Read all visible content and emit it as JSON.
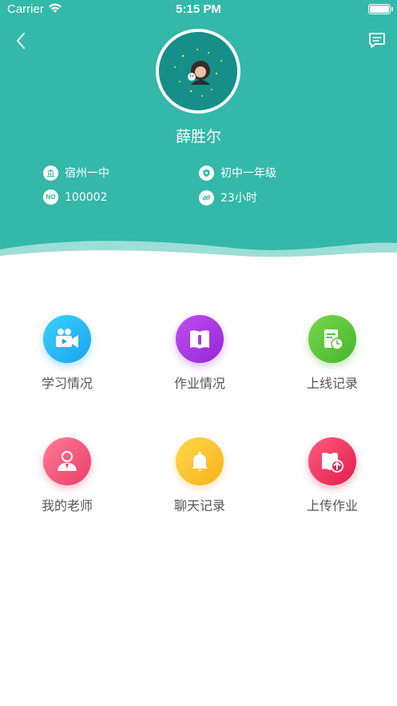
{
  "status_bar": {
    "carrier": "Carrier",
    "time": "5:15 PM"
  },
  "profile": {
    "name": "薛胜尔"
  },
  "info": {
    "school": "宿州一中",
    "grade": "初中一年级",
    "number_badge": "NO",
    "number": "100002",
    "duration": "23小时"
  },
  "menu": [
    {
      "label": "学习情况",
      "icon": "video-camera-icon",
      "color": "#2db8f0"
    },
    {
      "label": "作业情况",
      "icon": "book-icon",
      "color": "#a93ce0"
    },
    {
      "label": "上线记录",
      "icon": "document-clock-icon",
      "color": "#5cc23c"
    },
    {
      "label": "我的老师",
      "icon": "teacher-icon",
      "color": "#f2527a"
    },
    {
      "label": "聊天记录",
      "icon": "bell-icon",
      "color": "#fbc02d"
    },
    {
      "label": "上传作业",
      "icon": "upload-book-icon",
      "color": "#ef2f5a"
    }
  ]
}
